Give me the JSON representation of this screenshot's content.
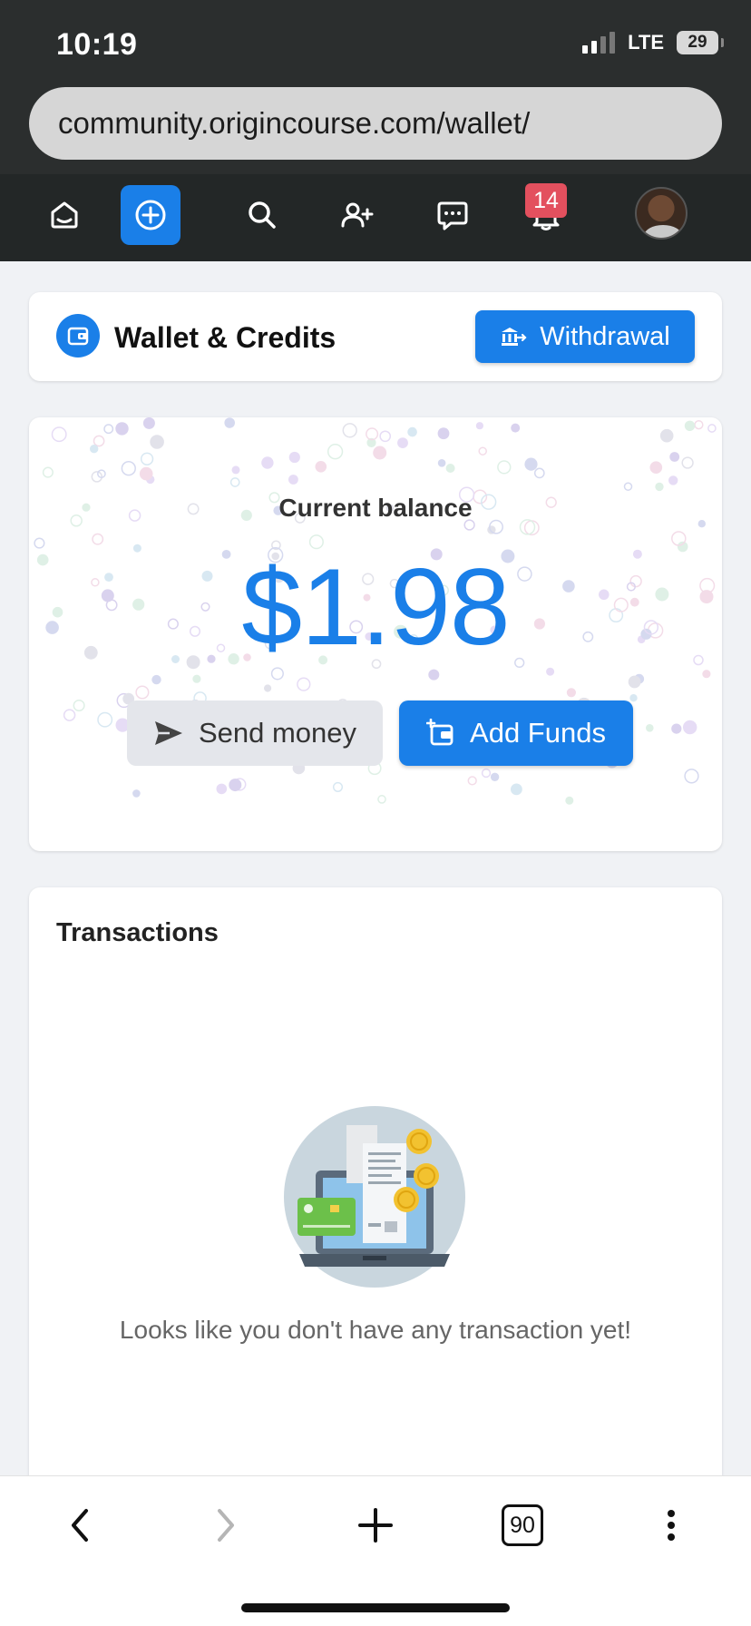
{
  "status_bar": {
    "time": "10:19",
    "network": "LTE",
    "battery": "29"
  },
  "browser": {
    "url": "community.origincourse.com/wallet/",
    "tab_count": "90"
  },
  "nav": {
    "notification_count": "14",
    "icons": [
      "home-icon",
      "create-icon",
      "search-icon",
      "add-friend-icon",
      "chat-icon",
      "bell-icon",
      "avatar"
    ]
  },
  "header": {
    "title": "Wallet & Credits",
    "withdraw_label": "Withdrawal"
  },
  "balance": {
    "label": "Current balance",
    "amount": "$1.98",
    "send_label": "Send money",
    "add_label": "Add Funds"
  },
  "transactions": {
    "title": "Transactions",
    "empty_message": "Looks like you don't have any transaction yet!"
  },
  "colors": {
    "accent": "#1a7fe8",
    "badge": "#e3505e",
    "nav_bg": "#232727"
  }
}
